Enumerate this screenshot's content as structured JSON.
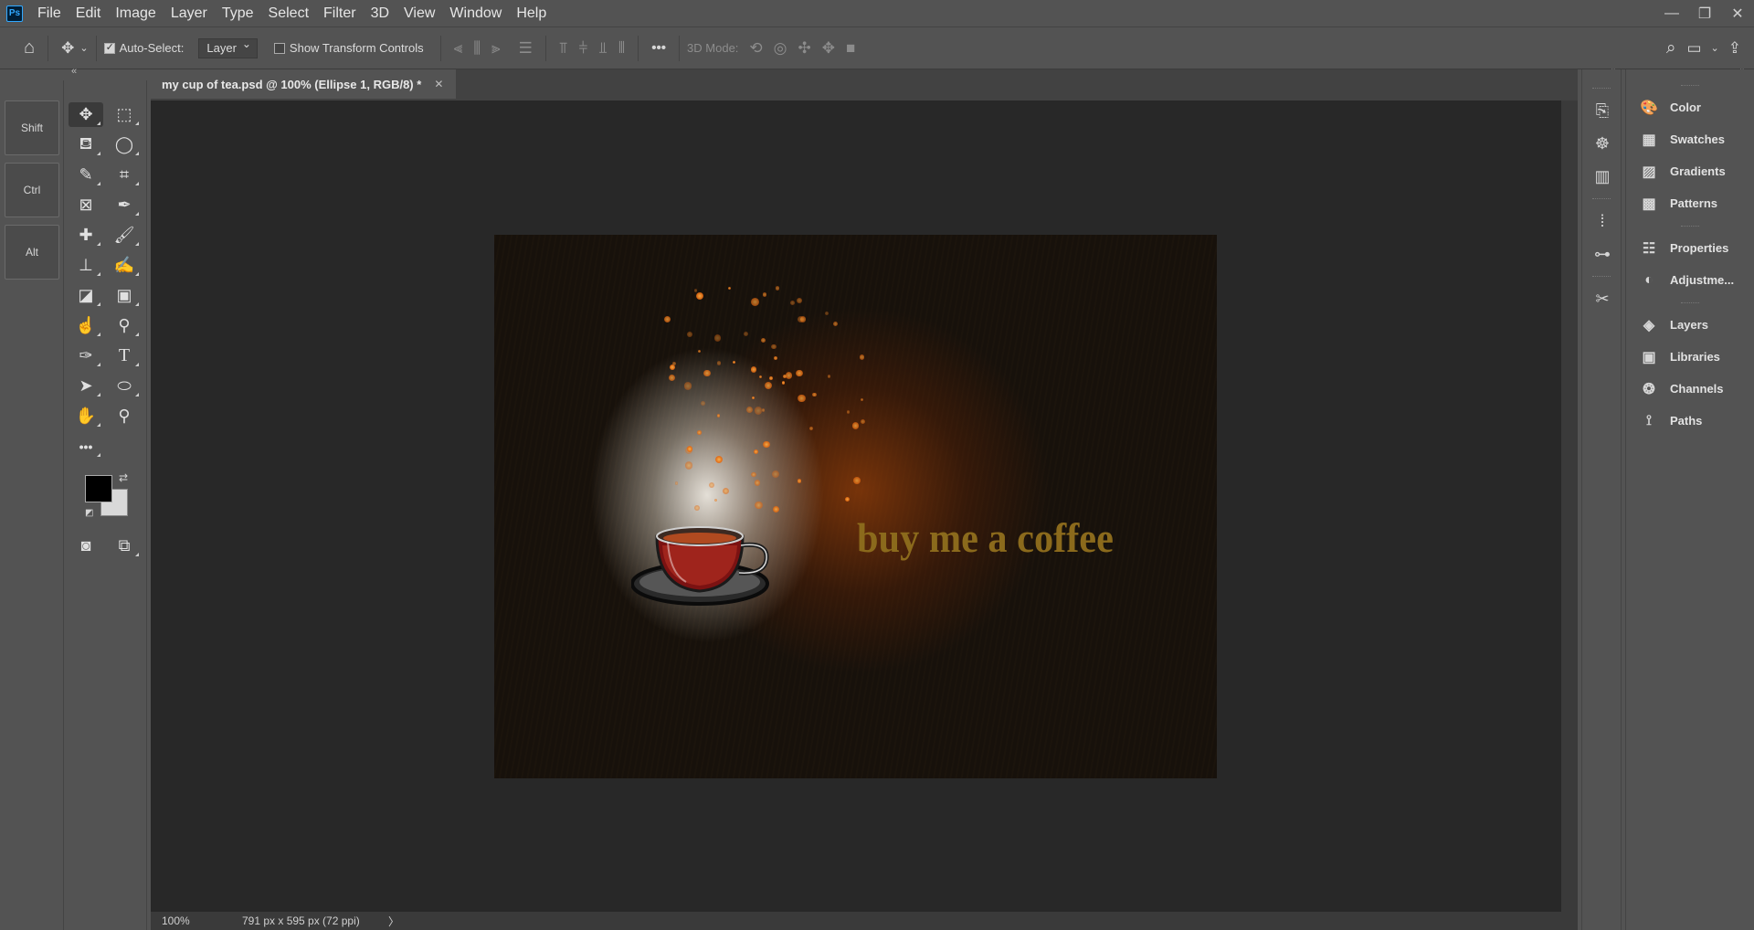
{
  "menubar": {
    "logo": "Ps",
    "items": [
      "File",
      "Edit",
      "Image",
      "Layer",
      "Type",
      "Select",
      "Filter",
      "3D",
      "View",
      "Window",
      "Help"
    ]
  },
  "options": {
    "auto_select_label": "Auto-Select:",
    "auto_select_checked": true,
    "auto_select_value": "Layer",
    "transform_controls_label": "Show Transform Controls",
    "more_label": "•••",
    "mode_3d_label": "3D Mode:"
  },
  "modifier_keys": [
    "Shift",
    "Ctrl",
    "Alt"
  ],
  "document": {
    "tab_title": "my cup of tea.psd @ 100% (Ellipse 1, RGB/8) *",
    "art_text": "buy me a coffee"
  },
  "status": {
    "zoom": "100%",
    "info": "791 px x 595 px (72 ppi)",
    "arrow": "〉"
  },
  "panels": {
    "items": [
      "Color",
      "Swatches",
      "Gradients",
      "Patterns",
      "Properties",
      "Adjustme...",
      "Layers",
      "Libraries",
      "Channels",
      "Paths"
    ]
  },
  "colors": {
    "foreground": "#000000",
    "background": "#d9d9d9",
    "text_accent": "#8b6a1c"
  }
}
